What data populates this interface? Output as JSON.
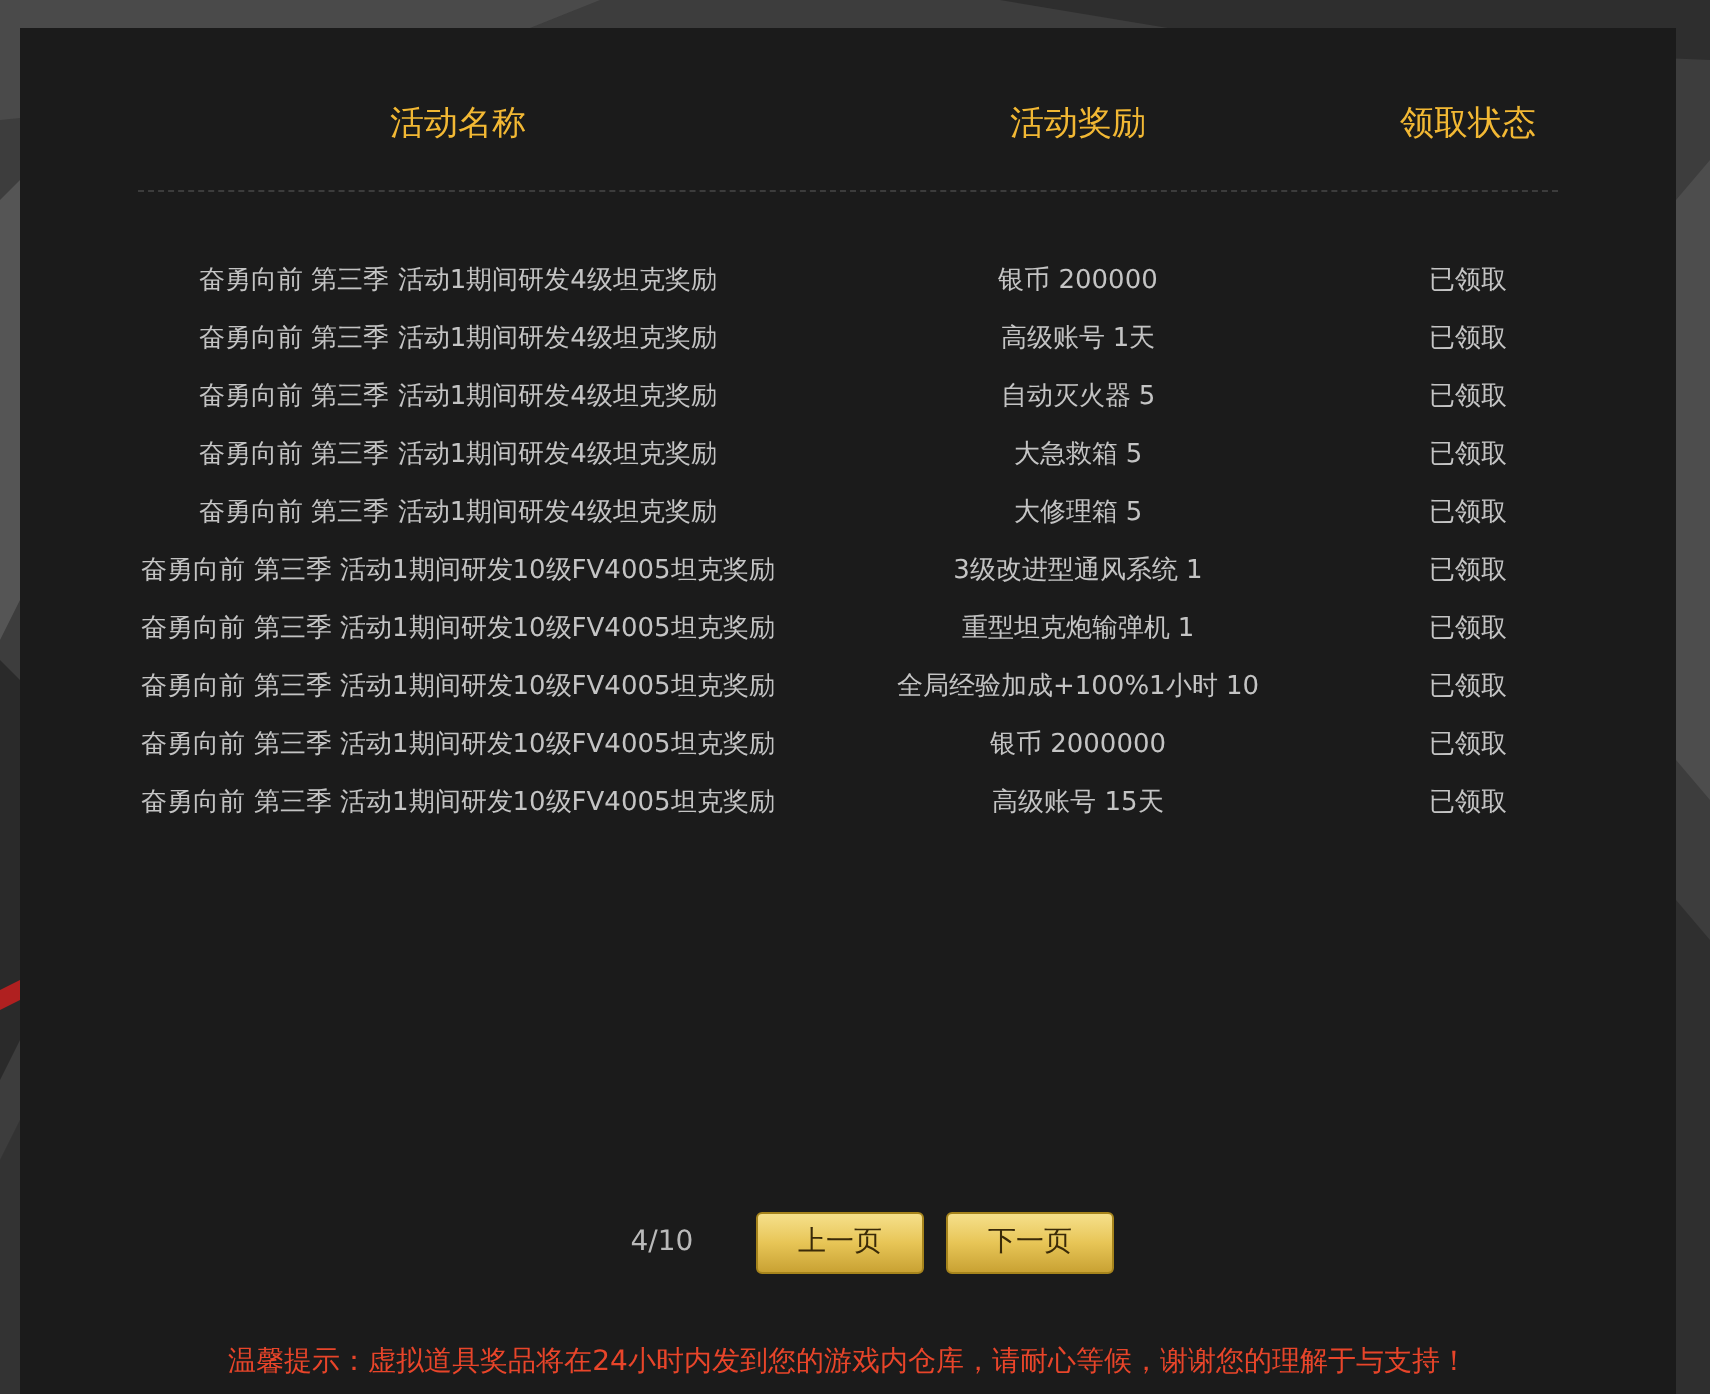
{
  "columns": [
    "活动名称",
    "活动奖励",
    "领取状态"
  ],
  "rows": [
    {
      "name": "奋勇向前 第三季 活动1期间研发4级坦克奖励",
      "reward": "银币 200000",
      "status": "已领取"
    },
    {
      "name": "奋勇向前 第三季 活动1期间研发4级坦克奖励",
      "reward": "高级账号 1天",
      "status": "已领取"
    },
    {
      "name": "奋勇向前 第三季 活动1期间研发4级坦克奖励",
      "reward": "自动灭火器 5",
      "status": "已领取"
    },
    {
      "name": "奋勇向前 第三季 活动1期间研发4级坦克奖励",
      "reward": "大急救箱 5",
      "status": "已领取"
    },
    {
      "name": "奋勇向前 第三季 活动1期间研发4级坦克奖励",
      "reward": "大修理箱 5",
      "status": "已领取"
    },
    {
      "name": "奋勇向前 第三季 活动1期间研发10级FV4005坦克奖励",
      "reward": "3级改进型通风系统 1",
      "status": "已领取"
    },
    {
      "name": "奋勇向前 第三季 活动1期间研发10级FV4005坦克奖励",
      "reward": "重型坦克炮输弹机 1",
      "status": "已领取"
    },
    {
      "name": "奋勇向前 第三季 活动1期间研发10级FV4005坦克奖励",
      "reward": "全局经验加成+100%1小时 10",
      "status": "已领取"
    },
    {
      "name": "奋勇向前 第三季 活动1期间研发10级FV4005坦克奖励",
      "reward": "银币 2000000",
      "status": "已领取"
    },
    {
      "name": "奋勇向前 第三季 活动1期间研发10级FV4005坦克奖励",
      "reward": "高级账号 15天",
      "status": "已领取"
    }
  ],
  "pagination": {
    "page": "4/10",
    "prev": "上一页",
    "next": "下一页"
  },
  "notice": "温馨提示：虚拟道具奖品将在24小时内发到您的游戏内仓库，请耐心等候，谢谢您的理解于与支持！"
}
